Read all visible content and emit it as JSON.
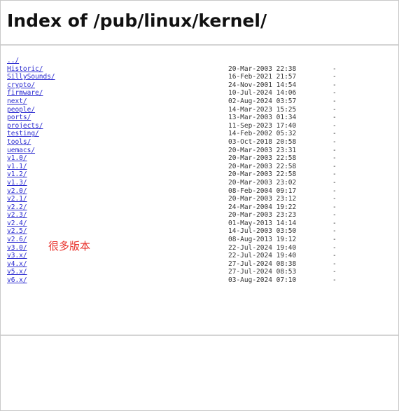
{
  "page": {
    "title": "Index of /pub/linux/kernel/"
  },
  "entries": [
    {
      "name": "../",
      "date": "",
      "size": ""
    },
    {
      "name": "Historic/",
      "date": "20-Mar-2003 22:38",
      "size": "-"
    },
    {
      "name": "SillySounds/",
      "date": "16-Feb-2021 21:57",
      "size": "-"
    },
    {
      "name": "crypto/",
      "date": "24-Nov-2001 14:54",
      "size": "-"
    },
    {
      "name": "firmware/",
      "date": "10-Jul-2024 14:06",
      "size": "-"
    },
    {
      "name": "next/",
      "date": "02-Aug-2024 03:57",
      "size": "-"
    },
    {
      "name": "people/",
      "date": "14-Mar-2023 15:25",
      "size": "-"
    },
    {
      "name": "ports/",
      "date": "13-Mar-2003 01:34",
      "size": "-"
    },
    {
      "name": "projects/",
      "date": "11-Sep-2023 17:40",
      "size": "-"
    },
    {
      "name": "testing/",
      "date": "14-Feb-2002 05:32",
      "size": "-"
    },
    {
      "name": "tools/",
      "date": "03-Oct-2018 20:58",
      "size": "-"
    },
    {
      "name": "uemacs/",
      "date": "20-Mar-2003 23:31",
      "size": "-"
    },
    {
      "name": "v1.0/",
      "date": "20-Mar-2003 22:58",
      "size": "-"
    },
    {
      "name": "v1.1/",
      "date": "20-Mar-2003 22:58",
      "size": "-"
    },
    {
      "name": "v1.2/",
      "date": "20-Mar-2003 22:58",
      "size": "-"
    },
    {
      "name": "v1.3/",
      "date": "20-Mar-2003 23:02",
      "size": "-"
    },
    {
      "name": "v2.0/",
      "date": "08-Feb-2004 09:17",
      "size": "-"
    },
    {
      "name": "v2.1/",
      "date": "20-Mar-2003 23:12",
      "size": "-"
    },
    {
      "name": "v2.2/",
      "date": "24-Mar-2004 19:22",
      "size": "-"
    },
    {
      "name": "v2.3/",
      "date": "20-Mar-2003 23:23",
      "size": "-"
    },
    {
      "name": "v2.4/",
      "date": "01-May-2013 14:14",
      "size": "-"
    },
    {
      "name": "v2.5/",
      "date": "14-Jul-2003 03:50",
      "size": "-"
    },
    {
      "name": "v2.6/",
      "date": "08-Aug-2013 19:12",
      "size": "-"
    },
    {
      "name": "v3.0/",
      "date": "22-Jul-2024 19:40",
      "size": "-"
    },
    {
      "name": "v3.x/",
      "date": "22-Jul-2024 19:40",
      "size": "-"
    },
    {
      "name": "v4.x/",
      "date": "27-Jul-2024 08:38",
      "size": "-"
    },
    {
      "name": "v5.x/",
      "date": "27-Jul-2024 08:53",
      "size": "-"
    },
    {
      "name": "v6.x/",
      "date": "03-Aug-2024 07:10",
      "size": "-"
    }
  ],
  "annotation": {
    "text": "很多版本",
    "color": "#e8302a"
  },
  "colors": {
    "link": "#2a2ad0",
    "rule": "#d4d4d4",
    "text": "#333333"
  }
}
